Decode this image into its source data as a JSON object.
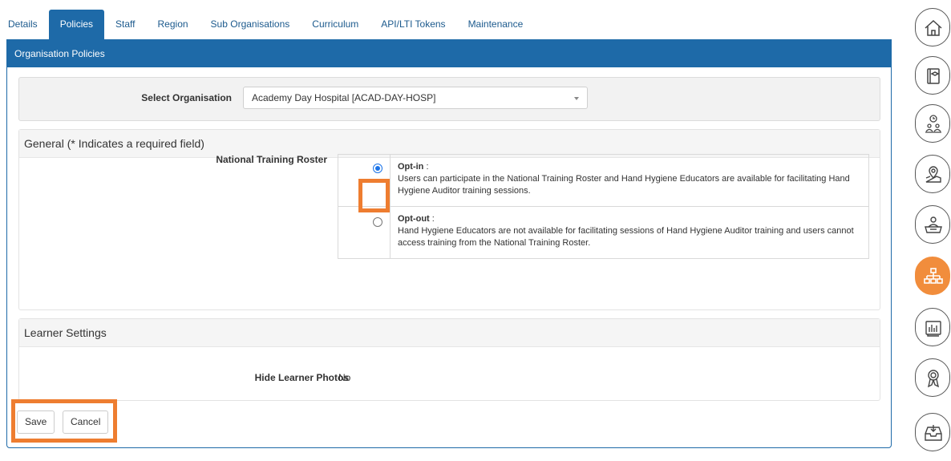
{
  "tabs": [
    {
      "label": "Details"
    },
    {
      "label": "Policies"
    },
    {
      "label": "Staff"
    },
    {
      "label": "Region"
    },
    {
      "label": "Sub Organisations"
    },
    {
      "label": "Curriculum"
    },
    {
      "label": "API/LTI Tokens"
    },
    {
      "label": "Maintenance"
    }
  ],
  "panel": {
    "title": "Organisation Policies"
  },
  "org": {
    "label": "Select Organisation",
    "selected": "Academy Day Hospital [ACAD-DAY-HOSP]"
  },
  "general": {
    "title": "General (* Indicates a required field)",
    "ntr_label": "National Training Roster",
    "options": [
      {
        "title": "Opt-in",
        "sep": " :",
        "desc": "Users can participate in the National Training Roster and Hand Hygiene Educators are available for facilitating Hand Hygiene Auditor training sessions.",
        "selected": true
      },
      {
        "title": "Opt-out",
        "sep": " :",
        "desc": "Hand Hygiene Educators are not available for facilitating sessions of Hand Hygiene Auditor training and users cannot access training from the National Training Roster.",
        "selected": false
      }
    ]
  },
  "learner": {
    "title": "Learner Settings",
    "hide_photos_label": "Hide Learner Photos",
    "hide_photos_value": "No"
  },
  "buttons": {
    "save": "Save",
    "cancel": "Cancel"
  },
  "colors": {
    "primary": "#1e6aa8",
    "highlight": "#ee7d30",
    "rail_active": "#f18d3c"
  },
  "rail": [
    {
      "icon": "home-icon"
    },
    {
      "icon": "course-book-icon"
    },
    {
      "icon": "scheduled-sessions-icon"
    },
    {
      "icon": "location-map-icon"
    },
    {
      "icon": "learner-desk-icon"
    },
    {
      "icon": "organisation-hierarchy-icon",
      "active": true
    },
    {
      "icon": "reports-chart-icon"
    },
    {
      "icon": "award-ribbon-icon"
    },
    {
      "icon": "inbox-download-icon"
    }
  ]
}
